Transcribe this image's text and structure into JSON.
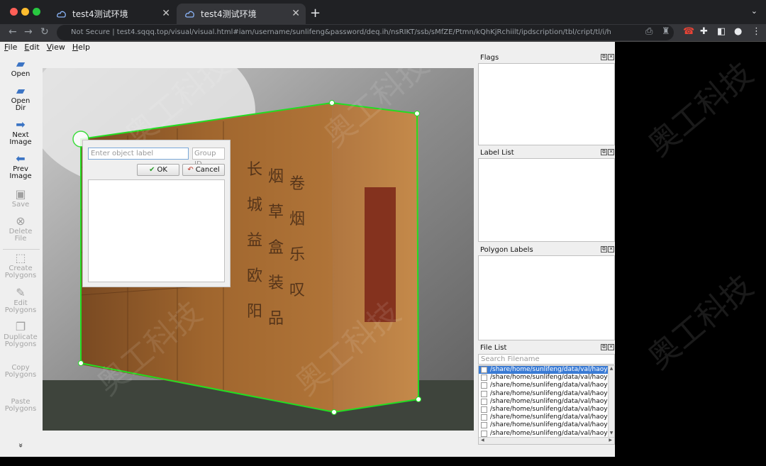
{
  "browser": {
    "tabs": [
      {
        "title": "test4测试环境",
        "active": false
      },
      {
        "title": "test4测试环境",
        "active": true
      }
    ],
    "address": "Not Secure | test4.sqqq.top/visual/visual.html#iam/username/sunlifeng&password/deq.ih/nsRIKT/ssb/sMfZE/Ptmn/kQhKjRchiilt/ipdscription/tbl/cript/tl/i/h",
    "colors": {
      "frame": "#202124",
      "toolbar": "#35363a",
      "active_tab": "#35363a"
    }
  },
  "menu": [
    "File",
    "Edit",
    "View",
    "Help"
  ],
  "tools": [
    {
      "label": "Open",
      "icon": "open-icon",
      "enabled": true
    },
    {
      "label": "Open\nDir",
      "icon": "open-dir-icon",
      "enabled": true
    },
    {
      "label": "Next\nImage",
      "icon": "next-image-icon",
      "enabled": true
    },
    {
      "label": "Prev\nImage",
      "icon": "prev-image-icon",
      "enabled": true
    },
    {
      "label": "Save",
      "icon": "save-icon",
      "enabled": false
    },
    {
      "label": "Delete\nFile",
      "icon": "delete-file-icon",
      "enabled": false
    },
    {
      "label": "Create\nPolygons",
      "icon": "create-polygons-icon",
      "enabled": false
    },
    {
      "label": "Edit\nPolygons",
      "icon": "edit-polygons-icon",
      "enabled": false
    },
    {
      "label": "Duplicate\nPolygons",
      "icon": "duplicate-polygons-icon",
      "enabled": false
    },
    {
      "label": "Copy\nPolygons",
      "icon": "copy-polygons-icon",
      "enabled": false
    },
    {
      "label": "Paste\nPolygons",
      "icon": "paste-polygons-icon",
      "enabled": false
    }
  ],
  "more_glyph": "»",
  "dialog": {
    "label_placeholder": "Enter object label",
    "group_placeholder": "Group ID",
    "ok": "OK",
    "cancel": "Cancel"
  },
  "docks": {
    "flags": "Flags",
    "label_list": "Label List",
    "polygon_labels": "Polygon Labels",
    "file_list": "File List",
    "search_placeholder": "Search Filename",
    "files": [
      "/share/home/sunlifeng/data/val/haoy",
      "/share/home/sunlifeng/data/val/haoy",
      "/share/home/sunlifeng/data/val/haoy",
      "/share/home/sunlifeng/data/val/haoy",
      "/share/home/sunlifeng/data/val/haoy",
      "/share/home/sunlifeng/data/val/haoy",
      "/share/home/sunlifeng/data/val/haoy",
      "/share/home/sunlifeng/data/val/haoy",
      "/share/home/sunlifeng/data/val/haoy"
    ]
  },
  "watermark_text": "奥工科技",
  "box_vertical_texts": [
    "长城",
    "烟草",
    "益",
    "欧阳"
  ],
  "polygon_color": "#22dd22"
}
